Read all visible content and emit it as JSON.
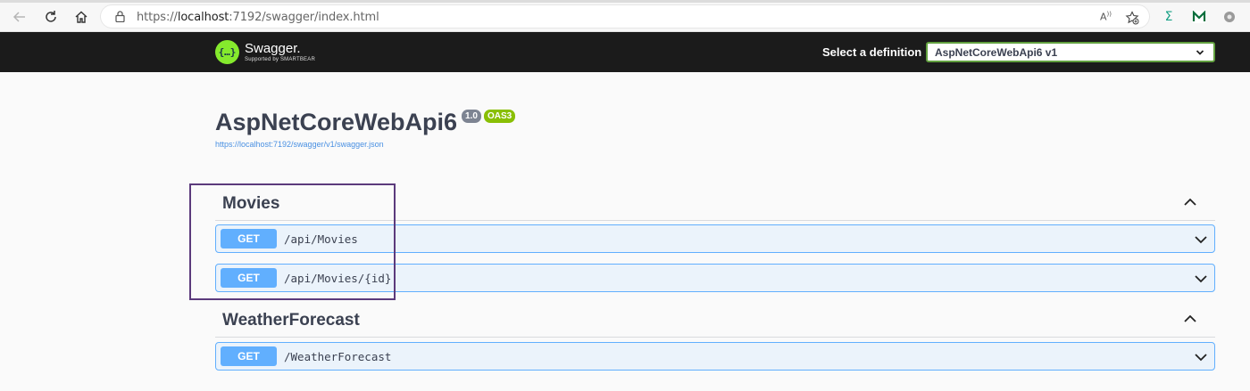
{
  "browser": {
    "url_prefix": "https://",
    "url_host": "localhost",
    "url_rest": ":7192/swagger/index.html"
  },
  "topbar": {
    "logo_name": "Swagger.",
    "logo_sub": "Supported by SMARTBEAR",
    "definition_label": "Select a definition",
    "definition_value": "AspNetCoreWebApi6 v1"
  },
  "info": {
    "title": "AspNetCoreWebApi6",
    "version": "1.0",
    "oas_badge": "OAS3",
    "spec_url": "https://localhost:7192/swagger/v1/swagger.json"
  },
  "tags": [
    {
      "name": "Movies",
      "operations": [
        {
          "method": "GET",
          "path": "/api/Movies"
        },
        {
          "method": "GET",
          "path": "/api/Movies/{id}"
        }
      ]
    },
    {
      "name": "WeatherForecast",
      "operations": [
        {
          "method": "GET",
          "path": "/WeatherForecast"
        }
      ]
    }
  ],
  "colors": {
    "get_accent": "#61affe",
    "get_bg": "#ebf3fb",
    "highlight_border": "#5b3a7c",
    "logo_green": "#85ea2d"
  }
}
